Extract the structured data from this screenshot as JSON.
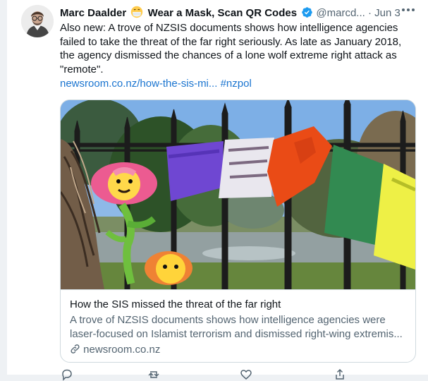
{
  "tweet": {
    "display_name": "Marc Daalder",
    "name_suffix": "Wear a Mask, Scan QR Codes",
    "handle": "@marcd...",
    "separator": "·",
    "date": "Jun 3",
    "text": "Also new: A trove of NZSIS documents shows how intelligence agencies failed to take the threat of the far right seriously. As late as January 2018, the agency dismissed the chances of a lone wolf extreme right attack as \"remote\".",
    "link_text": "newsroom.co.nz/how-the-sis-mi...",
    "hashtag": "#nzpol"
  },
  "card": {
    "title": "How the SIS missed the threat of the far right",
    "description": "A trove of NZSIS documents shows how intelligence agencies were laser-focused on Islamist terrorism and dismissed right-wing extremis...",
    "domain": "newsroom.co.nz"
  },
  "icons": {
    "emoji": "face-with-medical-mask",
    "verified": "verified-badge-icon",
    "more": "more-icon",
    "link": "link-icon"
  },
  "colors": {
    "link": "#1b75d0",
    "verified": "#1d9bf0",
    "secondary_text": "#536471",
    "text": "#0f1419",
    "border": "#cfd9de"
  }
}
